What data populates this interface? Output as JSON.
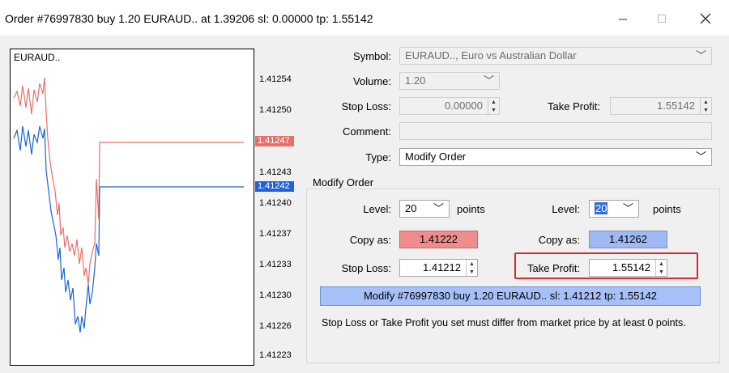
{
  "title": "Order #76997830 buy 1.20 EURAUD.. at 1.39206 sl: 0.00000 tp: 1.55142",
  "chart": {
    "symbol": "EURAUD..",
    "ticks": [
      "1.41254",
      "1.41250",
      "1.41247",
      "1.41243",
      "1.41242",
      "1.41240",
      "1.41237",
      "1.41233",
      "1.41230",
      "1.41226",
      "1.41223"
    ],
    "ask_tag": "1.41247",
    "bid_tag": "1.41242",
    "ask_color": "#e8706a",
    "bid_color": "#1f63d9"
  },
  "form": {
    "symbol_label": "Symbol:",
    "symbol_value": "EURAUD.., Euro vs Australian Dollar",
    "volume_label": "Volume:",
    "volume_value": "1.20",
    "stoploss_label": "Stop Loss:",
    "stoploss_value": "0.00000",
    "takeprofit_label": "Take Profit:",
    "takeprofit_value": "1.55142",
    "comment_label": "Comment:",
    "comment_value": "",
    "type_label": "Type:",
    "type_value": "Modify Order"
  },
  "modify": {
    "group_title": "Modify Order",
    "level_label": "Level:",
    "left_level": "20",
    "right_level": "20",
    "points": "points",
    "copyas_label": "Copy as:",
    "copy_left": "1.41222",
    "copy_right": "1.41262",
    "copy_left_color": "#f08c8c",
    "copy_right_color": "#9fb9f3",
    "sl_label": "Stop Loss:",
    "sl_value": "1.41212",
    "tp_label": "Take Profit:",
    "tp_value": "1.55142",
    "modify_button": "Modify #76997830 buy 1.20 EURAUD.. sl: 1.41212 tp: 1.55142",
    "note": "Stop Loss or Take Profit you set must differ from market price by at least 0 points."
  }
}
